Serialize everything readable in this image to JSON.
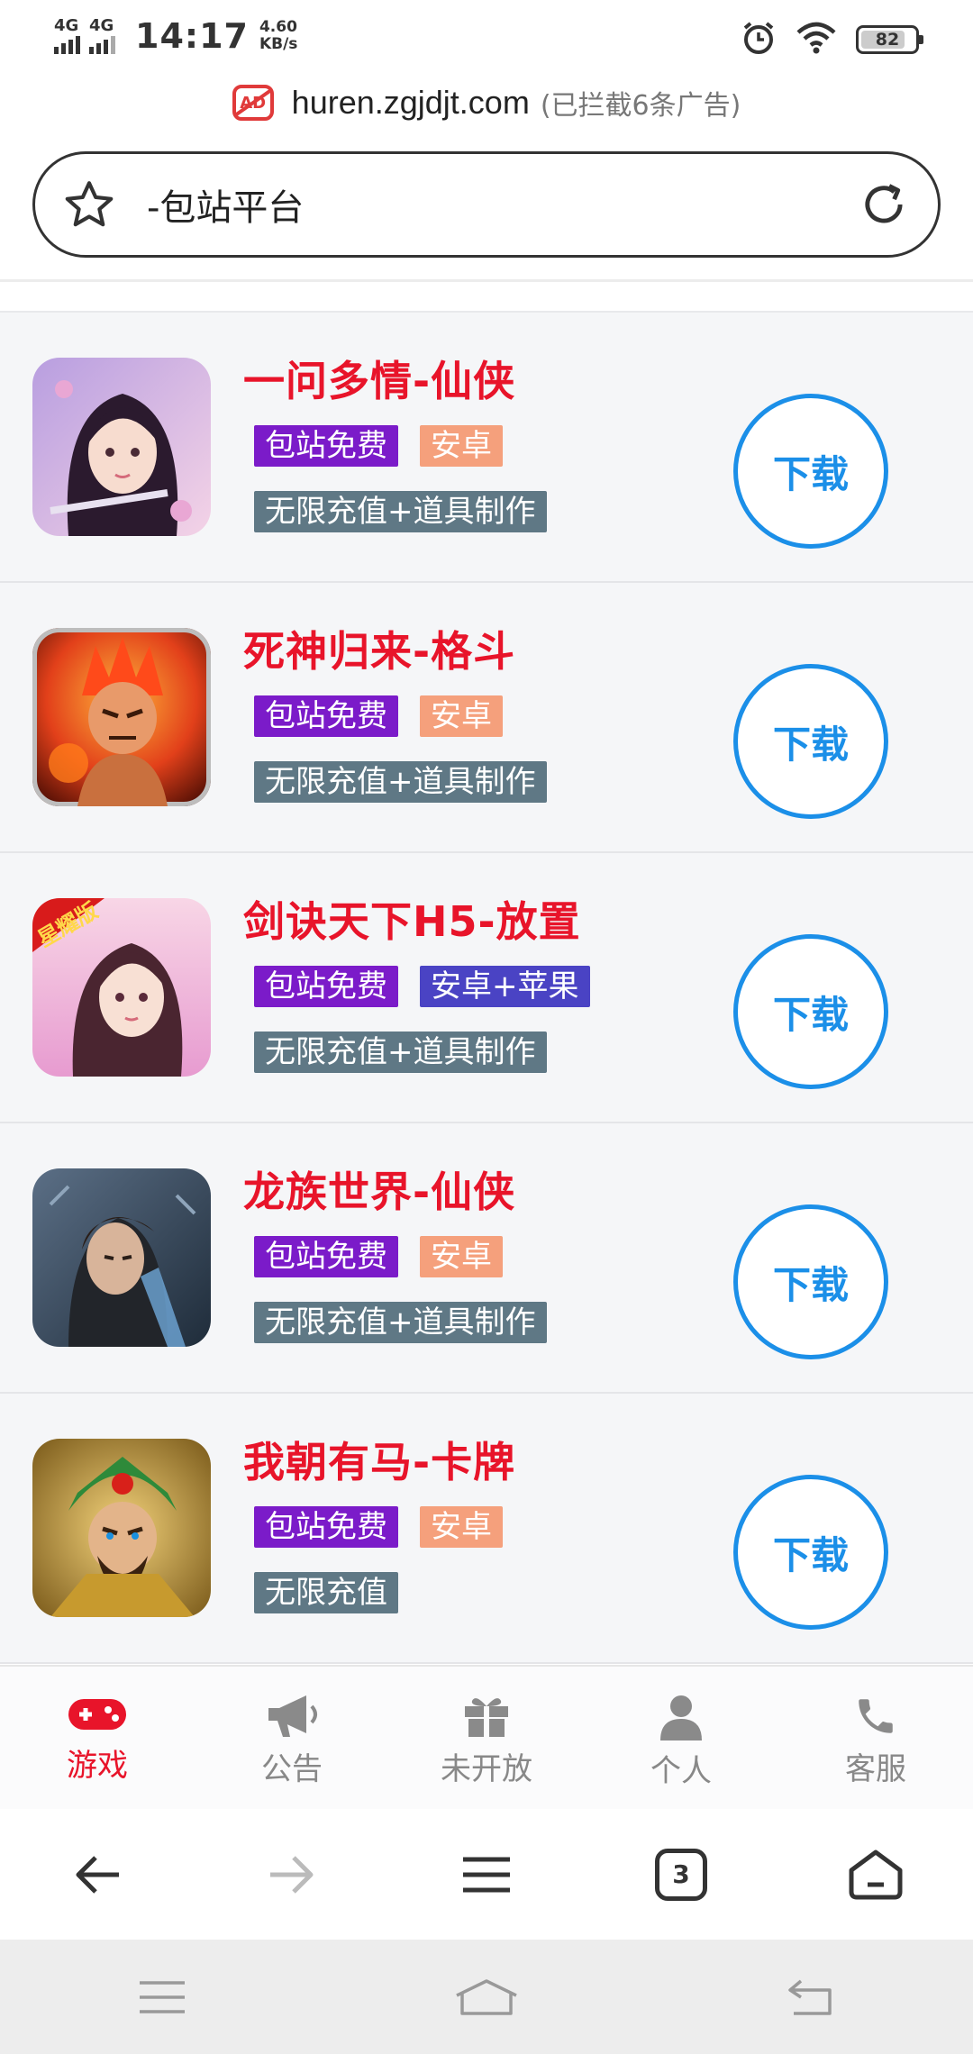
{
  "status_bar": {
    "signal1": "4G",
    "signal2": "4G",
    "time": "14:17",
    "speed_value": "4.60",
    "speed_unit": "KB/s",
    "battery": "82"
  },
  "url_bar": {
    "domain": "huren.zgjdjt.com",
    "blocked_text": "(已拦截6条广告)",
    "ad_icon_text": "AD"
  },
  "title_bar": {
    "title": "-包站平台"
  },
  "games": [
    {
      "name": "一问多情-仙侠",
      "badges": [
        {
          "text": "包站免费",
          "color": "purple"
        },
        {
          "text": "安卓",
          "color": "salmon"
        }
      ],
      "feature": "无限充值+道具制作",
      "download_label": "下载"
    },
    {
      "name": "死神归来-格斗",
      "badges": [
        {
          "text": "包站免费",
          "color": "purple"
        },
        {
          "text": "安卓",
          "color": "salmon"
        }
      ],
      "feature": "无限充值+道具制作",
      "download_label": "下载"
    },
    {
      "name": "剑诀天下H5-放置",
      "badges": [
        {
          "text": "包站免费",
          "color": "purple"
        },
        {
          "text": "安卓+苹果",
          "color": "blue"
        }
      ],
      "feature": "无限充值+道具制作",
      "download_label": "下载",
      "icon_ribbon": "星耀版"
    },
    {
      "name": "龙族世界-仙侠",
      "badges": [
        {
          "text": "包站免费",
          "color": "purple"
        },
        {
          "text": "安卓",
          "color": "salmon"
        }
      ],
      "feature": "无限充值+道具制作",
      "download_label": "下载"
    },
    {
      "name": "我朝有马-卡牌",
      "badges": [
        {
          "text": "包站免费",
          "color": "purple"
        },
        {
          "text": "安卓",
          "color": "salmon"
        }
      ],
      "feature": "无限充值",
      "download_label": "下载"
    }
  ],
  "tab_nav": [
    {
      "label": "游戏",
      "icon": "gamepad-icon",
      "active": true
    },
    {
      "label": "公告",
      "icon": "megaphone-icon",
      "active": false
    },
    {
      "label": "未开放",
      "icon": "gift-icon",
      "active": false
    },
    {
      "label": "个人",
      "icon": "person-icon",
      "active": false
    },
    {
      "label": "客服",
      "icon": "phone-icon",
      "active": false
    }
  ],
  "browser_toolbar": {
    "tab_count": "3"
  },
  "colors": {
    "accent_red": "#e8142a",
    "download_blue": "#1b8fe8",
    "badge_purple": "#7b1bc9",
    "badge_salmon": "#f5a07c",
    "badge_blue": "#4a43c4",
    "feature_gray": "#5f7885"
  }
}
